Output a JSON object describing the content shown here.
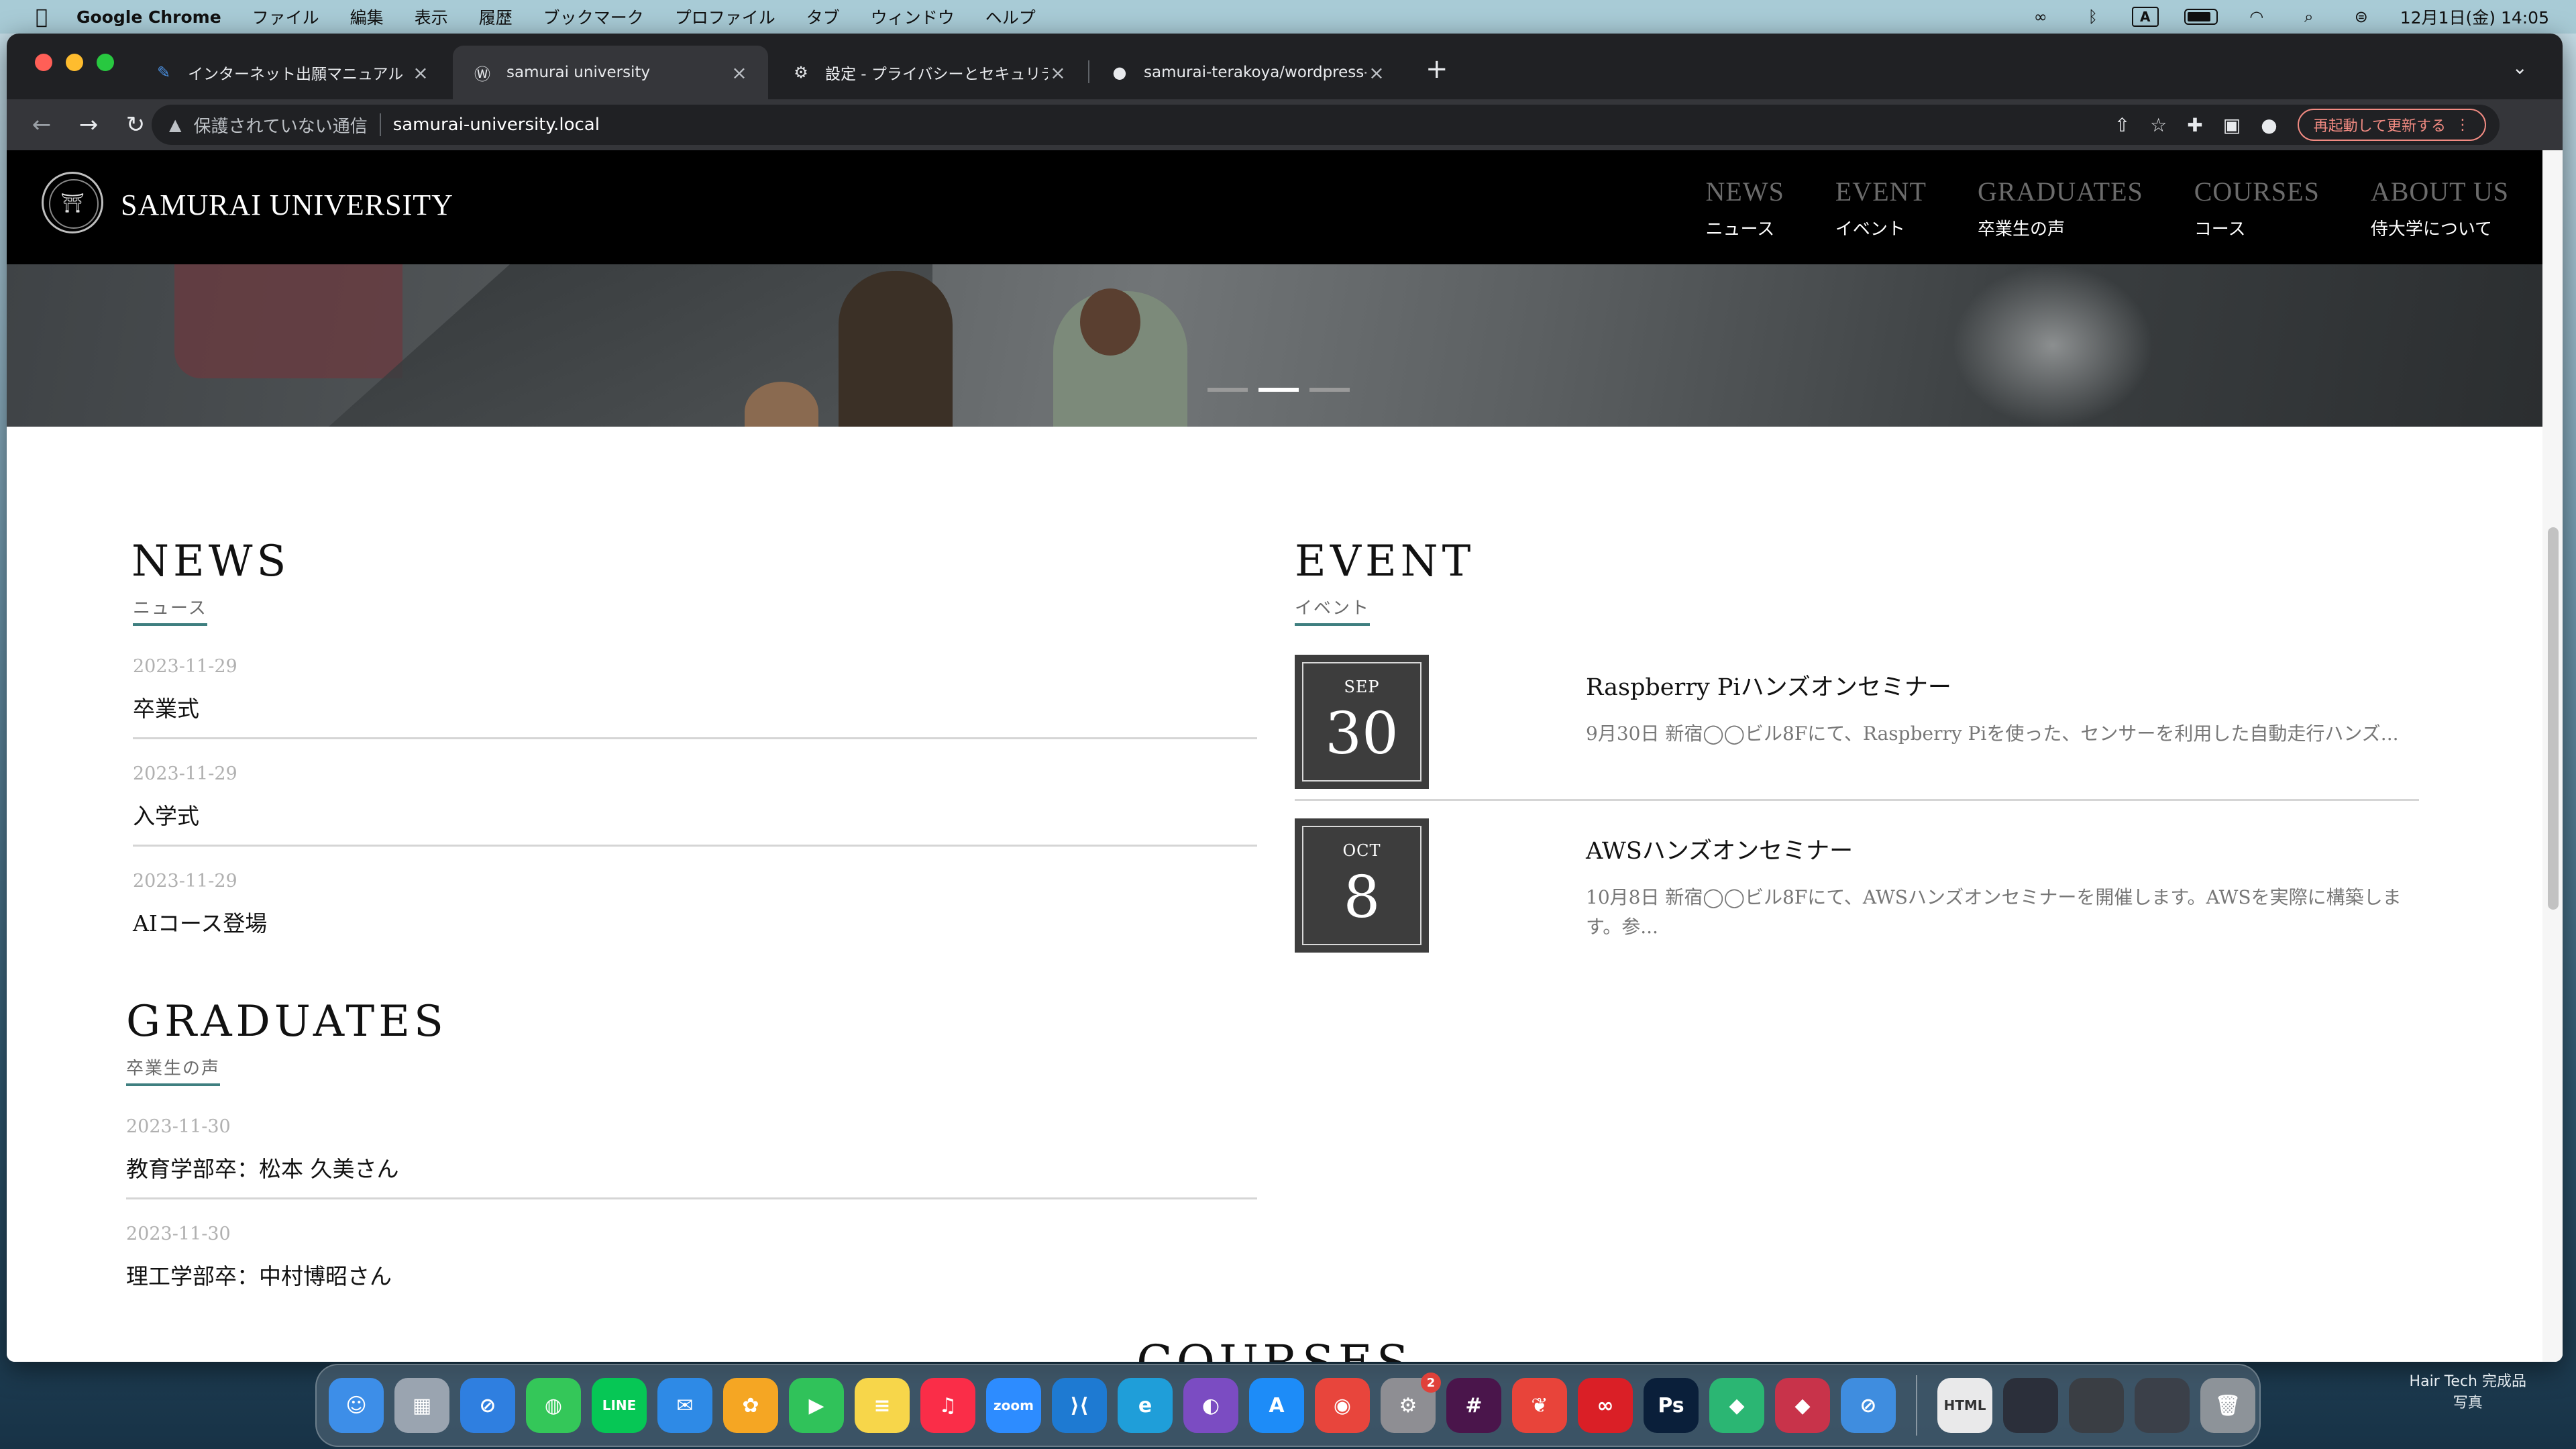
{
  "menubar": {
    "app_name": "Google Chrome",
    "items": [
      "ファイル",
      "編集",
      "表示",
      "履歴",
      "ブックマーク",
      "プロファイル",
      "タブ",
      "ウィンドウ",
      "ヘルプ"
    ],
    "input_indicator": "A",
    "clock": "12月1日(金)  14:05",
    "icons": [
      "apple-icon",
      "creative-cloud-icon",
      "bluetooth-icon",
      "input-method-icon",
      "battery-icon",
      "wifi-icon",
      "spotlight-icon",
      "control-center-icon"
    ]
  },
  "browser": {
    "tabs": [
      {
        "title": "インターネット出願マニュアル",
        "icon": "manual-favicon"
      },
      {
        "title": "samurai university",
        "icon": "wordpress-favicon"
      },
      {
        "title": "設定 - プライバシーとセキュリテ",
        "icon": "settings-favicon"
      },
      {
        "title": "samurai-terakoya/wordpress-",
        "icon": "github-favicon"
      }
    ],
    "new_tab": "+",
    "insecure_label": "保護されていない通信",
    "url": "samurai-university.local",
    "update_button": "再起動して更新する"
  },
  "site": {
    "title": "SAMURAI UNIVERSITY",
    "nav": [
      {
        "en": "NEWS",
        "ja": "ニュース"
      },
      {
        "en": "EVENT",
        "ja": "イベント"
      },
      {
        "en": "GRADUATES",
        "ja": "卒業生の声"
      },
      {
        "en": "COURSES",
        "ja": "コース"
      },
      {
        "en": "ABOUT US",
        "ja": "侍大学について"
      }
    ],
    "hero_slides": 3,
    "hero_active_slide": 2
  },
  "news": {
    "heading": "NEWS",
    "sub": "ニュース",
    "posts": [
      {
        "date": "2023-11-29",
        "title": "卒業式"
      },
      {
        "date": "2023-11-29",
        "title": "入学式"
      },
      {
        "date": "2023-11-29",
        "title": "AIコース登場"
      }
    ]
  },
  "graduates": {
    "heading": "GRADUATES",
    "sub": "卒業生の声",
    "posts": [
      {
        "date": "2023-11-30",
        "title": "教育学部卒：松本 久美さん"
      },
      {
        "date": "2023-11-30",
        "title": "理工学部卒：中村博昭さん"
      }
    ]
  },
  "event": {
    "heading": "EVENT",
    "sub": "イベント",
    "items": [
      {
        "month": "SEP",
        "day": "30",
        "title": "Raspberry Piハンズオンセミナー",
        "desc": "9月30日 新宿◯◯ビル8Fにて、Raspberry Piを使った、センサーを利用した自動走行ハンズ..."
      },
      {
        "month": "OCT",
        "day": "8",
        "title": "AWSハンズオンセミナー",
        "desc": "10月8日 新宿◯◯ビル8Fにて、AWSハンズオンセミナーを開催します。AWSを実際に構築します。参..."
      }
    ]
  },
  "courses": {
    "heading": "COURSES"
  },
  "dock": {
    "apps": [
      {
        "name": "finder",
        "glyph": "☺",
        "color": "#3d8ee8"
      },
      {
        "name": "launchpad",
        "glyph": "▦",
        "color": "#9aa4b0"
      },
      {
        "name": "safari",
        "glyph": "⊘",
        "color": "#2f7fe0"
      },
      {
        "name": "messages",
        "glyph": "◍",
        "color": "#34c759"
      },
      {
        "name": "line",
        "glyph": "LINE",
        "color": "#06c755"
      },
      {
        "name": "mail",
        "glyph": "✉",
        "color": "#2e8ae6"
      },
      {
        "name": "photos",
        "glyph": "✿",
        "color": "#f5a623"
      },
      {
        "name": "facetime",
        "glyph": "▶",
        "color": "#30c25a"
      },
      {
        "name": "notes",
        "glyph": "≡",
        "color": "#f7d64a"
      },
      {
        "name": "music",
        "glyph": "♫",
        "color": "#fa2d48"
      },
      {
        "name": "zoom",
        "glyph": "zoom",
        "color": "#2d8cff"
      },
      {
        "name": "vscode",
        "glyph": "⟩⟨",
        "color": "#1e7ad2"
      },
      {
        "name": "edge",
        "glyph": "e",
        "color": "#1f9ed9"
      },
      {
        "name": "github-desktop",
        "glyph": "◐",
        "color": "#7b4cc2"
      },
      {
        "name": "app-store",
        "glyph": "A",
        "color": "#1d8cf8"
      },
      {
        "name": "chrome",
        "glyph": "◉",
        "color": "#e8453c"
      },
      {
        "name": "system-settings",
        "glyph": "⚙",
        "color": "#8e8e93",
        "badge": "2"
      },
      {
        "name": "slack",
        "glyph": "#",
        "color": "#4a154b"
      },
      {
        "name": "scrapbox",
        "glyph": "❦",
        "color": "#e8443a"
      },
      {
        "name": "creative-cloud",
        "glyph": "∞",
        "color": "#da1f26"
      },
      {
        "name": "photoshop",
        "glyph": "Ps",
        "color": "#0a1f3a"
      },
      {
        "name": "mamp",
        "glyph": "◆",
        "color": "#2bb673"
      },
      {
        "name": "cursor",
        "glyph": "◆",
        "color": "#c8334a"
      },
      {
        "name": "safari-alt",
        "glyph": "⊘",
        "color": "#3f8ddf"
      }
    ],
    "right_items": [
      {
        "name": "html-file",
        "glyph": "HTML",
        "color": "#e9e9ea"
      },
      {
        "name": "screenshot-1",
        "glyph": "",
        "color": "#2b2f3a"
      },
      {
        "name": "screenshot-2",
        "glyph": "",
        "color": "#3a3e44"
      },
      {
        "name": "screenshot-3",
        "glyph": "",
        "color": "#3b4049"
      },
      {
        "name": "trash",
        "glyph": "🗑",
        "color": "#8d9399"
      }
    ]
  },
  "desktop": {
    "file_name": "Hair Tech 完成品",
    "file_sub": "写真"
  }
}
